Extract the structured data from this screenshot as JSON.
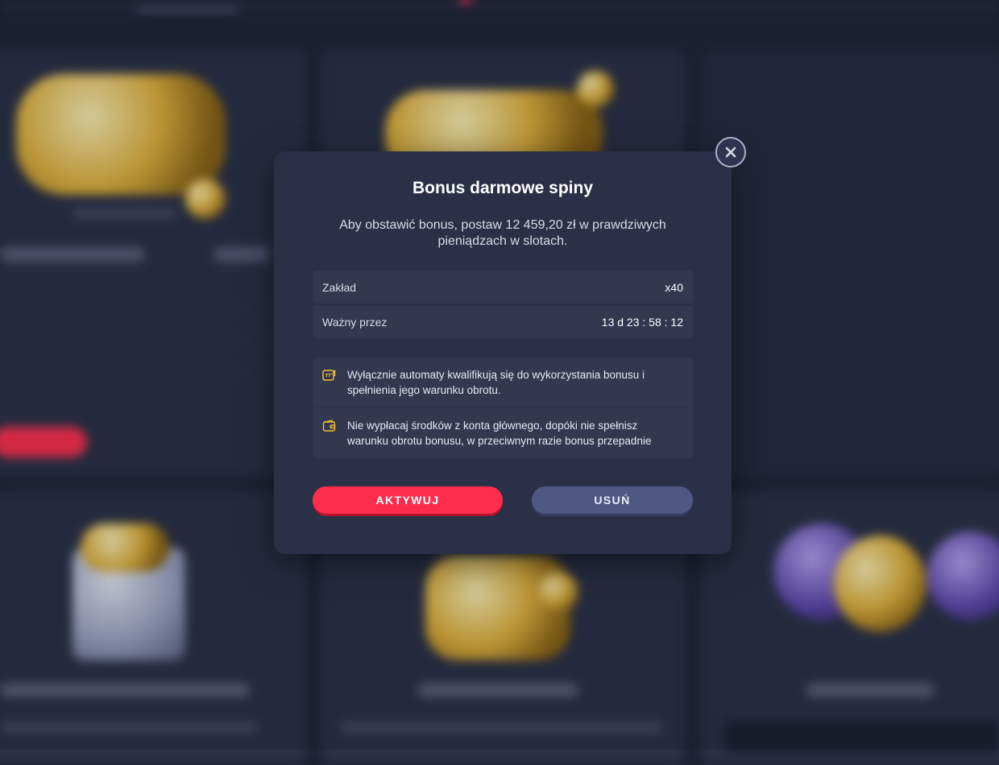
{
  "modal": {
    "title": "Bonus darmowe spiny",
    "description": "Aby obstawić bonus, postaw 12 459,20 zł w prawdziwych pieniądzach w slotach.",
    "rows": [
      {
        "label": "Zakład",
        "value": "x40"
      },
      {
        "label": "Ważny przez",
        "value": "13 d 23 : 58 : 12"
      }
    ],
    "notes": [
      {
        "icon": "slot-machine-icon",
        "text": "Wyłącznie automaty kwalifikują się do wykorzystania bonusu i spełnienia jego warunku obrotu."
      },
      {
        "icon": "wallet-icon",
        "text": "Nie wypłacaj środków z konta głównego, dopóki nie spełnisz warunku obrotu bonusu, w przeciwnym razie bonus przepadnie"
      }
    ],
    "activate_label": "AKTYWUJ",
    "remove_label": "USUŃ",
    "close_icon": "close-icon"
  },
  "colors": {
    "accent_red": "#ff2d4c",
    "secondary_button": "#4f5882",
    "modal_bg": "#2a3047",
    "note_icon": "#f2c230"
  }
}
